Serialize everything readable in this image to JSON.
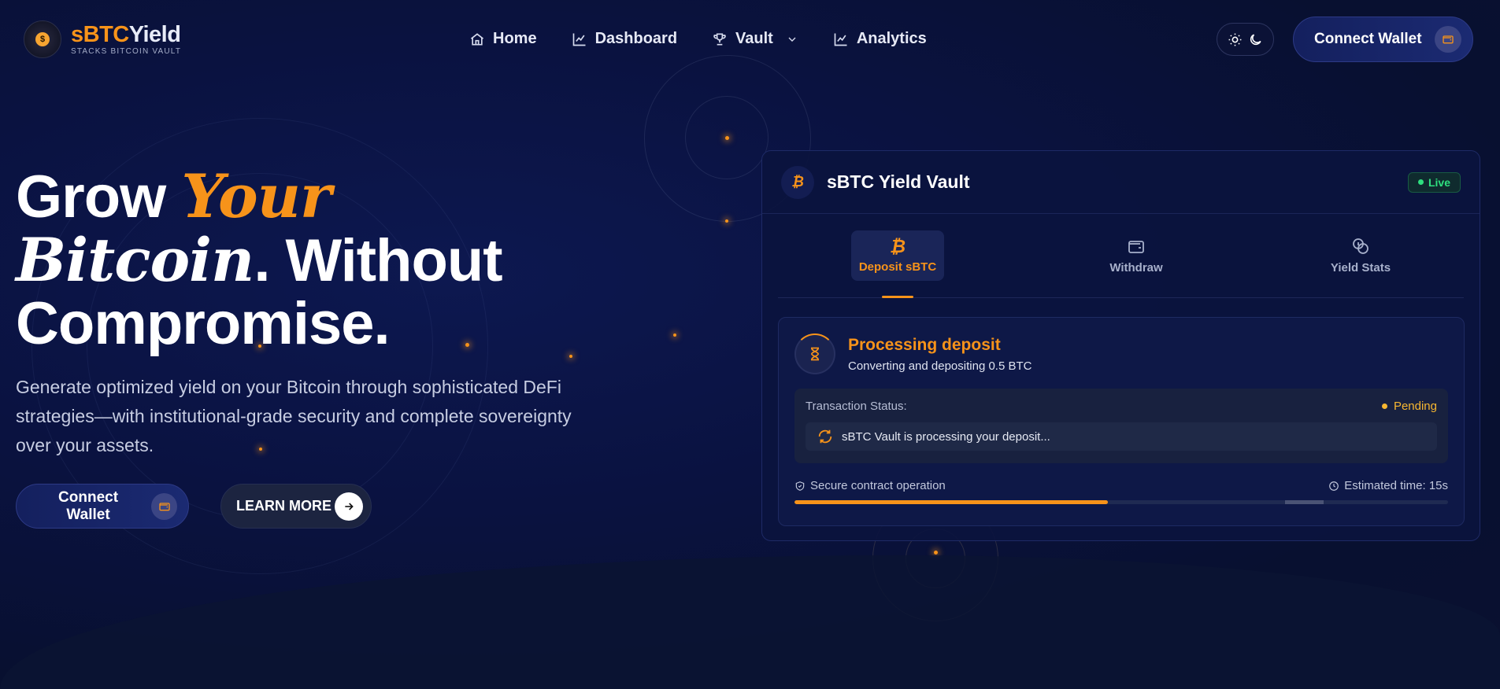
{
  "brand": {
    "name_part1": "sBTC",
    "name_part2": "Yield",
    "tagline": "STACKS BITCOIN VAULT",
    "logo_glyph": "$"
  },
  "nav": {
    "items": [
      {
        "label": "Home",
        "icon": "home-icon"
      },
      {
        "label": "Dashboard",
        "icon": "chart-line-icon"
      },
      {
        "label": "Vault",
        "icon": "trophy-icon"
      },
      {
        "label": "Analytics",
        "icon": "chart-line-icon"
      }
    ],
    "connect_wallet": "Connect Wallet"
  },
  "hero": {
    "title_1": "Grow ",
    "title_accent": "Your",
    "title_serif": "Bitcoin",
    "title_2": ". Without",
    "title_3": "Compromise.",
    "description": "Generate optimized yield on your Bitcoin through sophisticated DeFi strategies—with institutional-grade security and complete sovereignty over your assets.",
    "connect_wallet": "Connect Wallet",
    "learn_more": "LEARN MORE"
  },
  "vault_card": {
    "btc_glyph": "₿",
    "title": "sBTC Yield Vault",
    "live": "Live",
    "tabs": [
      {
        "label": "Deposit sBTC",
        "icon": "bitcoin-icon",
        "active": true
      },
      {
        "label": "Withdraw",
        "icon": "wallet-icon",
        "active": false
      },
      {
        "label": "Yield Stats",
        "icon": "coins-icon",
        "active": false
      }
    ],
    "processing": {
      "title": "Processing deposit",
      "subtitle": "Converting and depositing 0.5 BTC",
      "status_label": "Transaction Status:",
      "status": "Pending",
      "message": "sBTC Vault is processing your deposit...",
      "secure": "Secure contract operation",
      "estimate": "Estimated time: 15s",
      "progress": 0.48
    }
  },
  "colors": {
    "accent": "#f7931a",
    "live": "#2ee07f",
    "pending": "#f7b731",
    "background": "#0a1240"
  }
}
